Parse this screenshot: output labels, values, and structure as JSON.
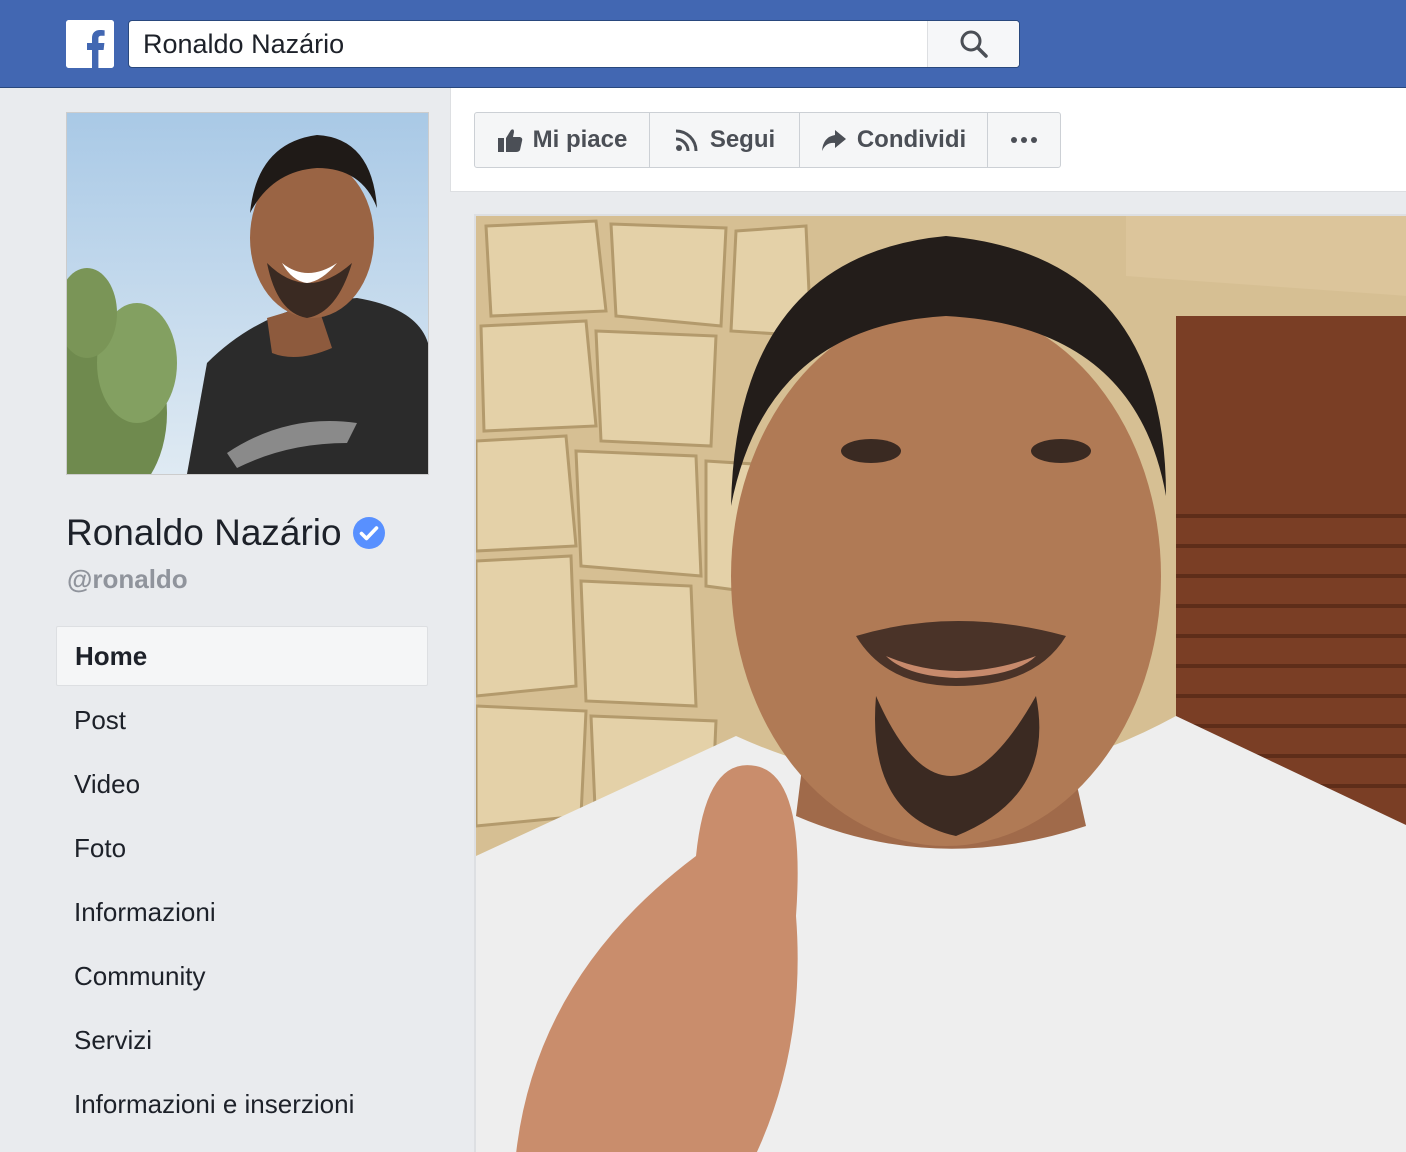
{
  "header": {
    "logo_icon": "facebook-f-icon",
    "search_value": "Ronaldo Nazário",
    "search_icon": "magnifier-icon"
  },
  "profile": {
    "name": "Ronaldo Nazário",
    "verified": true,
    "username": "@ronaldo",
    "picture": "profile-photo"
  },
  "nav": {
    "items": [
      {
        "label": "Home",
        "active": true
      },
      {
        "label": "Post"
      },
      {
        "label": "Video"
      },
      {
        "label": "Foto"
      },
      {
        "label": "Informazioni"
      },
      {
        "label": "Community"
      },
      {
        "label": "Servizi"
      },
      {
        "label": "Informazioni e inserzioni"
      }
    ]
  },
  "actions": {
    "like_label": "Mi piace",
    "like_icon": "thumbs-up-icon",
    "follow_label": "Segui",
    "follow_icon": "rss-icon",
    "share_label": "Condividi",
    "share_icon": "share-arrow-icon",
    "more_icon": "ellipsis-icon"
  },
  "colors": {
    "brand_blue": "#4267b2",
    "page_bg": "#e9ebee",
    "verified_blue": "#5890ff",
    "text": "#1d2129",
    "muted_text": "#90949c"
  }
}
